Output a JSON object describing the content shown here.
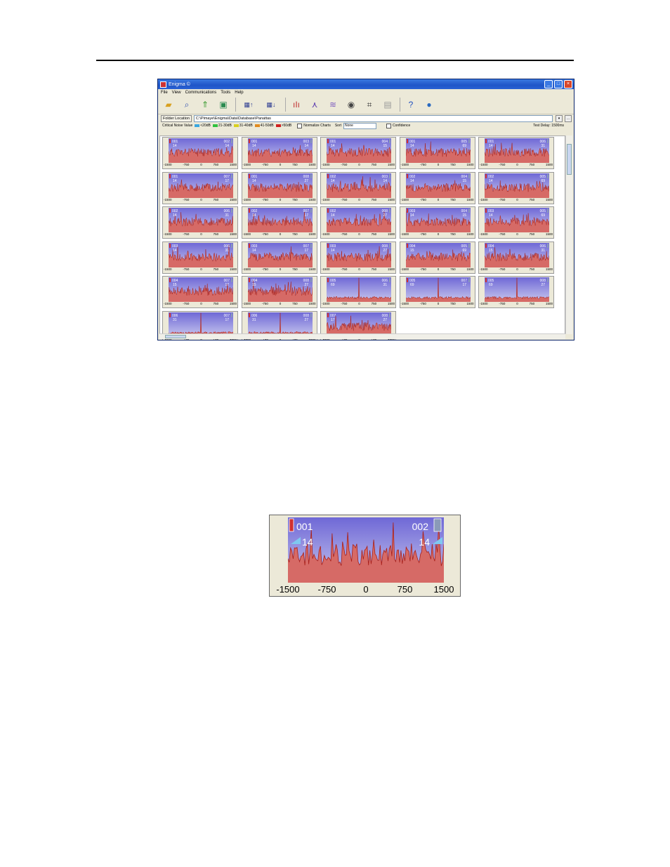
{
  "window": {
    "title": "Enigma ©",
    "menu": [
      "File",
      "View",
      "Communications",
      "Tools",
      "Help"
    ],
    "toolbar_icons": [
      "open-folder-icon",
      "search-icon",
      "upload-icon",
      "refresh-icon",
      "download-up-icon",
      "download-down-icon",
      "spectrum-icon",
      "peak-icon",
      "overlay-icon",
      "target-icon",
      "settings-icon",
      "print-icon",
      "help-icon",
      "globe-icon"
    ],
    "folder_label": "Folder Location",
    "folder_path": "C:\\Pimaye\\Enigma\\Data\\Database\\Panattas",
    "critical_label": "Critical Noise Value",
    "legend": [
      {
        "label": "<20dB",
        "color": "#3aa7e0"
      },
      {
        "label": "21-30dB",
        "color": "#2fc140"
      },
      {
        "label": "31-40dB",
        "color": "#d8d020"
      },
      {
        "label": "41-50dB",
        "color": "#e08a20"
      },
      {
        "label": ">50dB",
        "color": "#d02020"
      }
    ],
    "normalize_label": "Normalize Charts",
    "sort_label": "Sort",
    "sort_value": "None",
    "confidence_label": "Confidence",
    "delay_label": "Test Delay: 1500ms"
  },
  "axis_ticks": [
    "-1500",
    "-750",
    "0",
    "750",
    "1500"
  ],
  "panels": [
    {
      "left": "001",
      "right": "002",
      "lv": "14",
      "rv": "14"
    },
    {
      "left": "001",
      "right": "003",
      "lv": "14",
      "rv": "14"
    },
    {
      "left": "001",
      "right": "004",
      "lv": "14",
      "rv": "15"
    },
    {
      "left": "001",
      "right": "005",
      "lv": "14",
      "rv": "69"
    },
    {
      "left": "001",
      "right": "006",
      "lv": "14",
      "rv": "31"
    },
    {
      "left": "001",
      "right": "007",
      "lv": "14",
      "rv": "17"
    },
    {
      "left": "001",
      "right": "008",
      "lv": "14",
      "rv": "27"
    },
    {
      "left": "002",
      "right": "003",
      "lv": "14",
      "rv": "14"
    },
    {
      "left": "002",
      "right": "004",
      "lv": "14",
      "rv": "15"
    },
    {
      "left": "002",
      "right": "005",
      "lv": "14",
      "rv": "69"
    },
    {
      "left": "002",
      "right": "006",
      "lv": "14",
      "rv": "31"
    },
    {
      "left": "002",
      "right": "007",
      "lv": "14",
      "rv": "17"
    },
    {
      "left": "002",
      "right": "008",
      "lv": "14",
      "rv": "27"
    },
    {
      "left": "003",
      "right": "004",
      "lv": "14",
      "rv": "15"
    },
    {
      "left": "003",
      "right": "005",
      "lv": "14",
      "rv": "69"
    },
    {
      "left": "003",
      "right": "006",
      "lv": "14",
      "rv": "31"
    },
    {
      "left": "003",
      "right": "007",
      "lv": "14",
      "rv": "17"
    },
    {
      "left": "003",
      "right": "008",
      "lv": "14",
      "rv": "27"
    },
    {
      "left": "004",
      "right": "005",
      "lv": "15",
      "rv": "69"
    },
    {
      "left": "004",
      "right": "006",
      "lv": "15",
      "rv": "31"
    },
    {
      "left": "004",
      "right": "007",
      "lv": "15",
      "rv": "17"
    },
    {
      "left": "004",
      "right": "008",
      "lv": "15",
      "rv": "27"
    },
    {
      "left": "005",
      "right": "006",
      "lv": "69",
      "rv": "31"
    },
    {
      "left": "005",
      "right": "007",
      "lv": "69",
      "rv": "17"
    },
    {
      "left": "005",
      "right": "008",
      "lv": "69",
      "rv": "27"
    },
    {
      "left": "006",
      "right": "007",
      "lv": "31",
      "rv": "17"
    },
    {
      "left": "006",
      "right": "008",
      "lv": "31",
      "rv": "27"
    },
    {
      "left": "007",
      "right": "008",
      "lv": "17",
      "rv": "27"
    }
  ],
  "zoom": {
    "left": "001",
    "right": "002",
    "left_value": "14",
    "right_value": "14"
  },
  "colors": {
    "plot_top": "#6f68d6",
    "plot_bottom": "#c8c8ee",
    "signal": "#a8201a",
    "fill": "#d66a66"
  }
}
